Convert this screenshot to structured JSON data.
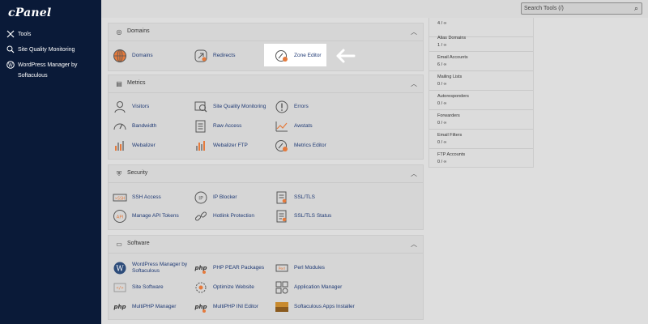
{
  "sidebar": {
    "logo": "cPanel",
    "items": [
      {
        "label": "Tools",
        "icon": "tools-icon"
      },
      {
        "label": "Site Quality Monitoring",
        "icon": "search-monitor-icon"
      },
      {
        "label": "WordPress Manager by Softaculous",
        "icon": "wordpress-icon"
      }
    ]
  },
  "search": {
    "placeholder": "Search Tools (/)"
  },
  "sections": {
    "domains": {
      "title": "Domains",
      "items": {
        "domains": "Domains",
        "redirects": "Redirects",
        "zone_editor": "Zone Editor"
      }
    },
    "metrics": {
      "title": "Metrics",
      "items": {
        "visitors": "Visitors",
        "site_quality": "Site Quality Monitoring",
        "errors": "Errors",
        "bandwidth": "Bandwidth",
        "raw_access": "Raw Access",
        "awstats": "Awstats",
        "webalizer": "Webalizer",
        "webalizer_ftp": "Webalizer FTP",
        "metrics_editor": "Metrics Editor"
      }
    },
    "security": {
      "title": "Security",
      "items": {
        "ssh": "SSH Access",
        "ip_blocker": "IP Blocker",
        "ssl_tls": "SSL/TLS",
        "api_tokens": "Manage API Tokens",
        "hotlink": "Hotlink Protection",
        "ssl_status": "SSL/TLS Status"
      }
    },
    "software": {
      "title": "Software",
      "items": {
        "wp_manager": "WordPress Manager by Softaculous",
        "php_pear": "PHP PEAR Packages",
        "perl": "Perl Modules",
        "site_software": "Site Software",
        "optimize": "Optimize Website",
        "app_manager": "Application Manager",
        "multiphp": "MultiPHP Manager",
        "multiphp_ini": "MultiPHP INI Editor",
        "softaculous": "Softaculous Apps Installer"
      }
    }
  },
  "stats": [
    {
      "label": "",
      "value": "4 / ∞"
    },
    {
      "label": "Alias Domains",
      "value": "1 / ∞"
    },
    {
      "label": "Email Accounts",
      "value": "6 / ∞"
    },
    {
      "label": "Mailing Lists",
      "value": "0 / ∞"
    },
    {
      "label": "Autoresponders",
      "value": "0 / ∞"
    },
    {
      "label": "Forwarders",
      "value": "0 / ∞"
    },
    {
      "label": "Email Filters",
      "value": "0 / ∞"
    },
    {
      "label": "FTP Accounts",
      "value": "0 / ∞"
    }
  ],
  "colors": {
    "sidebar": "#0a1a38",
    "link": "#1f3a75",
    "highlight": "#ffffff"
  }
}
